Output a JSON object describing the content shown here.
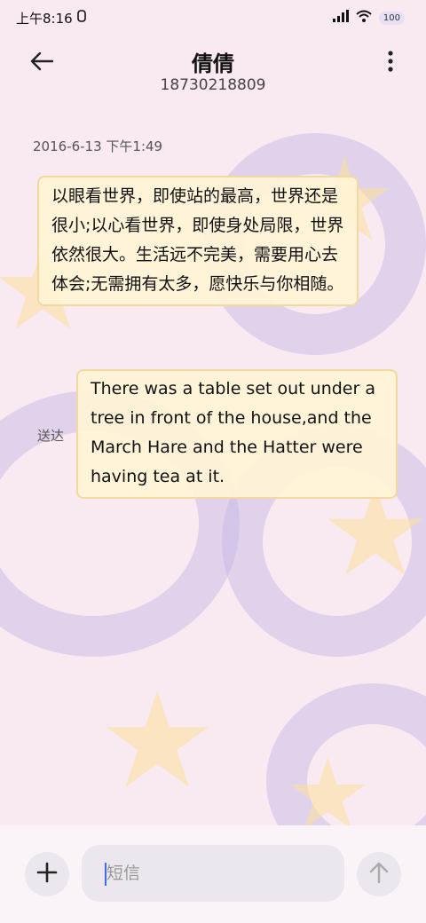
{
  "status_bar": {
    "time": "上午8:16",
    "battery": "100",
    "icons": [
      "alarm-icon",
      "signal-icon",
      "wifi-icon",
      "battery-icon"
    ]
  },
  "header": {
    "contact_name": "倩倩",
    "contact_number": "18730218809",
    "icons": [
      "arrow-left-icon",
      "more-vertical-icon"
    ]
  },
  "conversation": {
    "timestamp": "2016-6-13 下午1:49",
    "messages": [
      {
        "direction": "incoming",
        "text": "以眼看世界，即使站的最高，世界还是很小;以心看世界，即使身处局限，世界依然很大。生活远不完美，需要用心去体会;无需拥有太多，愿快乐与你相随。"
      },
      {
        "direction": "outgoing",
        "text": "There was a table set out under a tree in front of the house,and the March Hare and the Hatter were having tea at it.",
        "status": "送达"
      }
    ]
  },
  "composer": {
    "placeholder": "短信",
    "value": "",
    "icons": [
      "plus-icon",
      "arrow-up-icon"
    ]
  },
  "colors": {
    "background": "#f9eaf2",
    "bubble_fill": "#fff4d6",
    "bubble_border": "#f3d9a0",
    "accent_caret": "#3d6de6"
  }
}
